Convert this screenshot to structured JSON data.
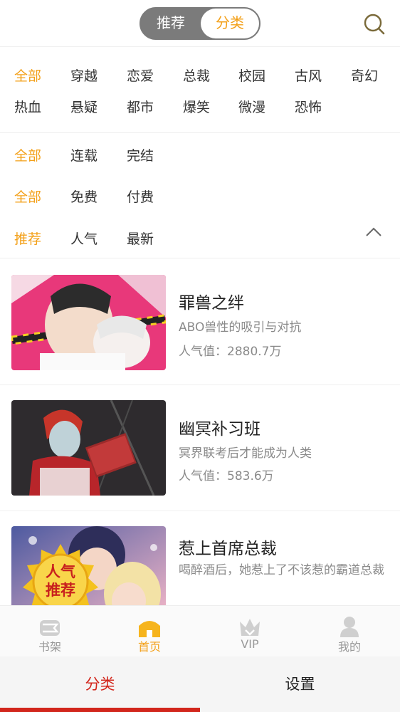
{
  "header": {
    "segment_left": "推荐",
    "segment_right": "分类",
    "search_icon": "search-icon"
  },
  "filters": {
    "genre_row1": [
      "全部",
      "穿越",
      "恋爱",
      "总裁",
      "校园",
      "古风",
      "奇幻"
    ],
    "genre_row2": [
      "热血",
      "悬疑",
      "都市",
      "爆笑",
      "微漫",
      "恐怖"
    ],
    "status": [
      "全部",
      "连载",
      "完结"
    ],
    "price": [
      "全部",
      "免费",
      "付费"
    ],
    "sort": [
      "推荐",
      "人气",
      "最新"
    ],
    "collapse_icon": "chevron-up-icon"
  },
  "books": [
    {
      "title": "罪兽之绊",
      "desc": "ABO兽性的吸引与对抗",
      "popularity": "人气值：2880.7万"
    },
    {
      "title": "幽冥补习班",
      "desc": "冥界联考后才能成为人类",
      "popularity": "人气值：583.6万"
    },
    {
      "title": "惹上首席总裁",
      "desc": "喝醉酒后，她惹上了不该惹的霸道总裁",
      "badge": "人气推荐"
    }
  ],
  "tabbar": [
    {
      "label": "书架",
      "icon": "bookshelf-icon"
    },
    {
      "label": "首页",
      "icon": "home-icon"
    },
    {
      "label": "VIP",
      "icon": "crown-icon"
    },
    {
      "label": "我的",
      "icon": "user-icon"
    }
  ],
  "sysbar": {
    "left": "分类",
    "right": "设置"
  },
  "colors": {
    "accent": "#f3a019",
    "red": "#d2261c",
    "gray_text": "#8a8a8a"
  }
}
